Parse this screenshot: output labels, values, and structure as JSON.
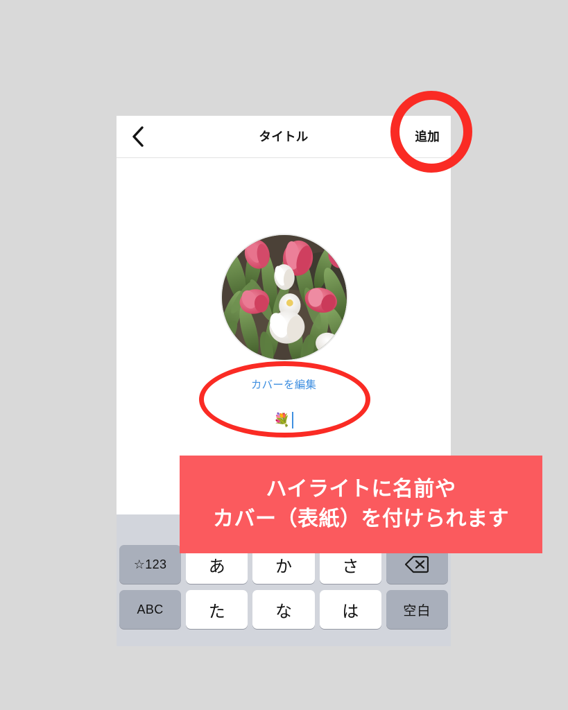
{
  "app": {
    "platform": "instagram-story-highlight-editor",
    "background_color": "#d9d9d9"
  },
  "nav_bar": {
    "back_icon": "chevron-left-icon",
    "title": "タイトル",
    "add_label": "追加"
  },
  "content": {
    "cover_image_alt": "ピンクと白のチューリップ",
    "edit_cover_label": "カバーを編集",
    "name_input": {
      "value": "💐",
      "placeholder": "",
      "caret_visible": true
    }
  },
  "annotations": {
    "circle_add_color": "#fa2b24",
    "ellipse_cover_color": "#fa2b24",
    "banner": {
      "background_color": "#fb5a5e",
      "text_color": "#ffffff",
      "line1": "ハイライトに名前や",
      "line2": "カバー（表紙）を付けられます"
    }
  },
  "keyboard": {
    "type": "japanese-kana",
    "background_color": "#d2d5dc",
    "rows": [
      [
        {
          "label": "☆123",
          "style": "dark",
          "name": "key-symbols-numbers"
        },
        {
          "label": "あ",
          "style": "light",
          "name": "key-a"
        },
        {
          "label": "か",
          "style": "light",
          "name": "key-ka"
        },
        {
          "label": "さ",
          "style": "light",
          "name": "key-sa"
        },
        {
          "label": "",
          "style": "dark",
          "name": "key-delete",
          "icon": "backspace-icon"
        }
      ],
      [
        {
          "label": "ABC",
          "style": "dark",
          "name": "key-abc"
        },
        {
          "label": "た",
          "style": "light",
          "name": "key-ta"
        },
        {
          "label": "な",
          "style": "light",
          "name": "key-na"
        },
        {
          "label": "は",
          "style": "light",
          "name": "key-ha"
        },
        {
          "label": "空白",
          "style": "dark",
          "name": "key-space"
        }
      ]
    ]
  },
  "image_palette": {
    "pink_petal": "#d9546e",
    "pink_petal_light": "#e8899c",
    "white_petal": "#f4f2ee",
    "leaf_green": "#6d8f4e",
    "leaf_green_dark": "#47612f",
    "soil": "#4a4038"
  }
}
